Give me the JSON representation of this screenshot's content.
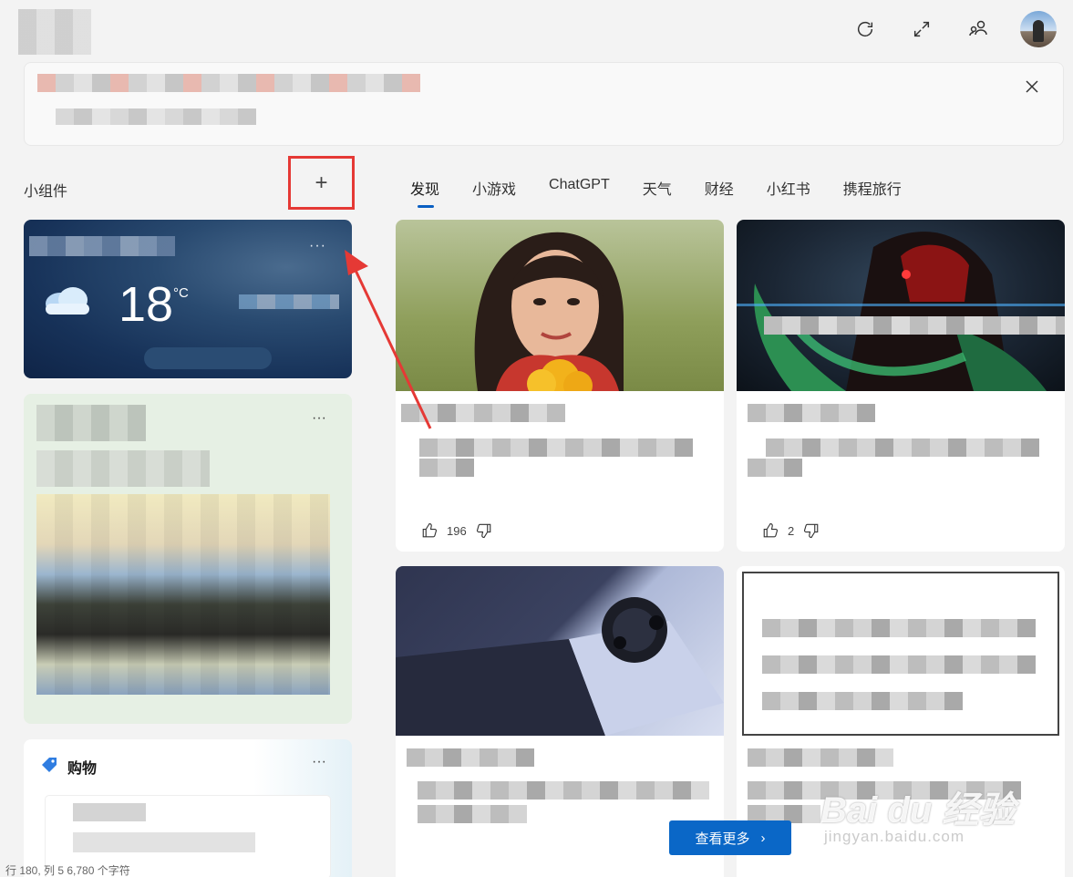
{
  "toolbar": {
    "refresh_icon": "refresh-icon",
    "expand_icon": "expand-icon",
    "people_icon": "people-icon",
    "avatar_icon": "avatar"
  },
  "widgets": {
    "title": "小组件",
    "add_label": "+"
  },
  "tabs": [
    {
      "label": "发现",
      "active": true
    },
    {
      "label": "小游戏"
    },
    {
      "label": "ChatGPT"
    },
    {
      "label": "天气"
    },
    {
      "label": "财经"
    },
    {
      "label": "小红书"
    },
    {
      "label": "携程旅行"
    }
  ],
  "weather": {
    "temperature": "18",
    "unit": "°C",
    "more": "···"
  },
  "widget2": {
    "more": "···"
  },
  "shopping": {
    "title": "购物",
    "more": "···"
  },
  "feed": {
    "card1": {
      "likes": "196"
    },
    "card2": {
      "likes": "2"
    },
    "see_more": "查看更多",
    "see_more_chevron": "›"
  },
  "watermark": {
    "brand": "Bai du 经验",
    "url": "jingyan.baidu.com"
  },
  "status": {
    "text": "行 180, 列 5    6,780 个字符"
  },
  "colors": {
    "accent": "#0a67c7",
    "highlight": "#e53935"
  }
}
